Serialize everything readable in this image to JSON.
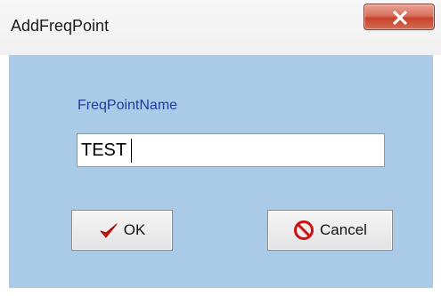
{
  "window": {
    "title": "AddFreqPoint",
    "close_icon": "close-x-icon"
  },
  "form": {
    "label": "FreqPointName",
    "input_value": "TEST"
  },
  "buttons": {
    "ok_label": "OK",
    "ok_icon": "checkmark-icon",
    "cancel_label": "Cancel",
    "cancel_icon": "prohibited-icon"
  },
  "colors": {
    "client_background": "#a9cbe8",
    "label_text": "#1e3c9c",
    "close_button": "#c8442d",
    "ok_check": "#cc1111",
    "cancel_icon": "#cc1111"
  }
}
